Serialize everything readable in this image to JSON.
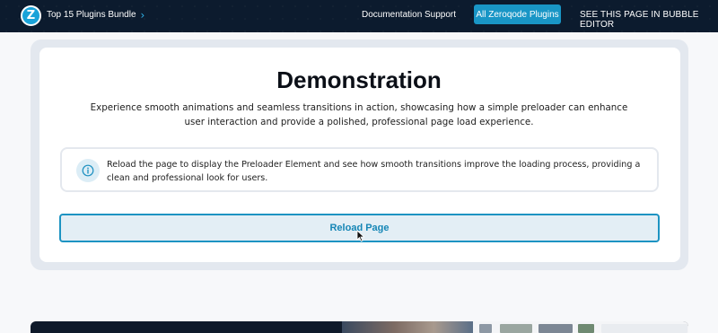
{
  "header": {
    "logo_letter": "Z",
    "bundle_label": "Top 15 Plugins Bundle",
    "chevron_glyph": "›",
    "nav_links": {
      "documentation": "Documentation",
      "support": "Support"
    },
    "primary_button": "All Zeroqode Plugins",
    "editor_link": "SEE THIS PAGE IN BUBBLE EDITOR",
    "colors": {
      "background": "#0c1b2e",
      "accent": "#1996c6"
    }
  },
  "demo": {
    "title": "Demonstration",
    "description": "Experience smooth animations and seamless transitions in action, showcasing how a simple preloader can enhance user interaction and provide a polished, professional page load experience.",
    "info_icon": "info-circle-icon",
    "info_text": "Reload the page to display the Preloader Element and see how smooth transitions improve the loading process, providing a clean and professional look for users.",
    "reload_button": "Reload Page"
  }
}
